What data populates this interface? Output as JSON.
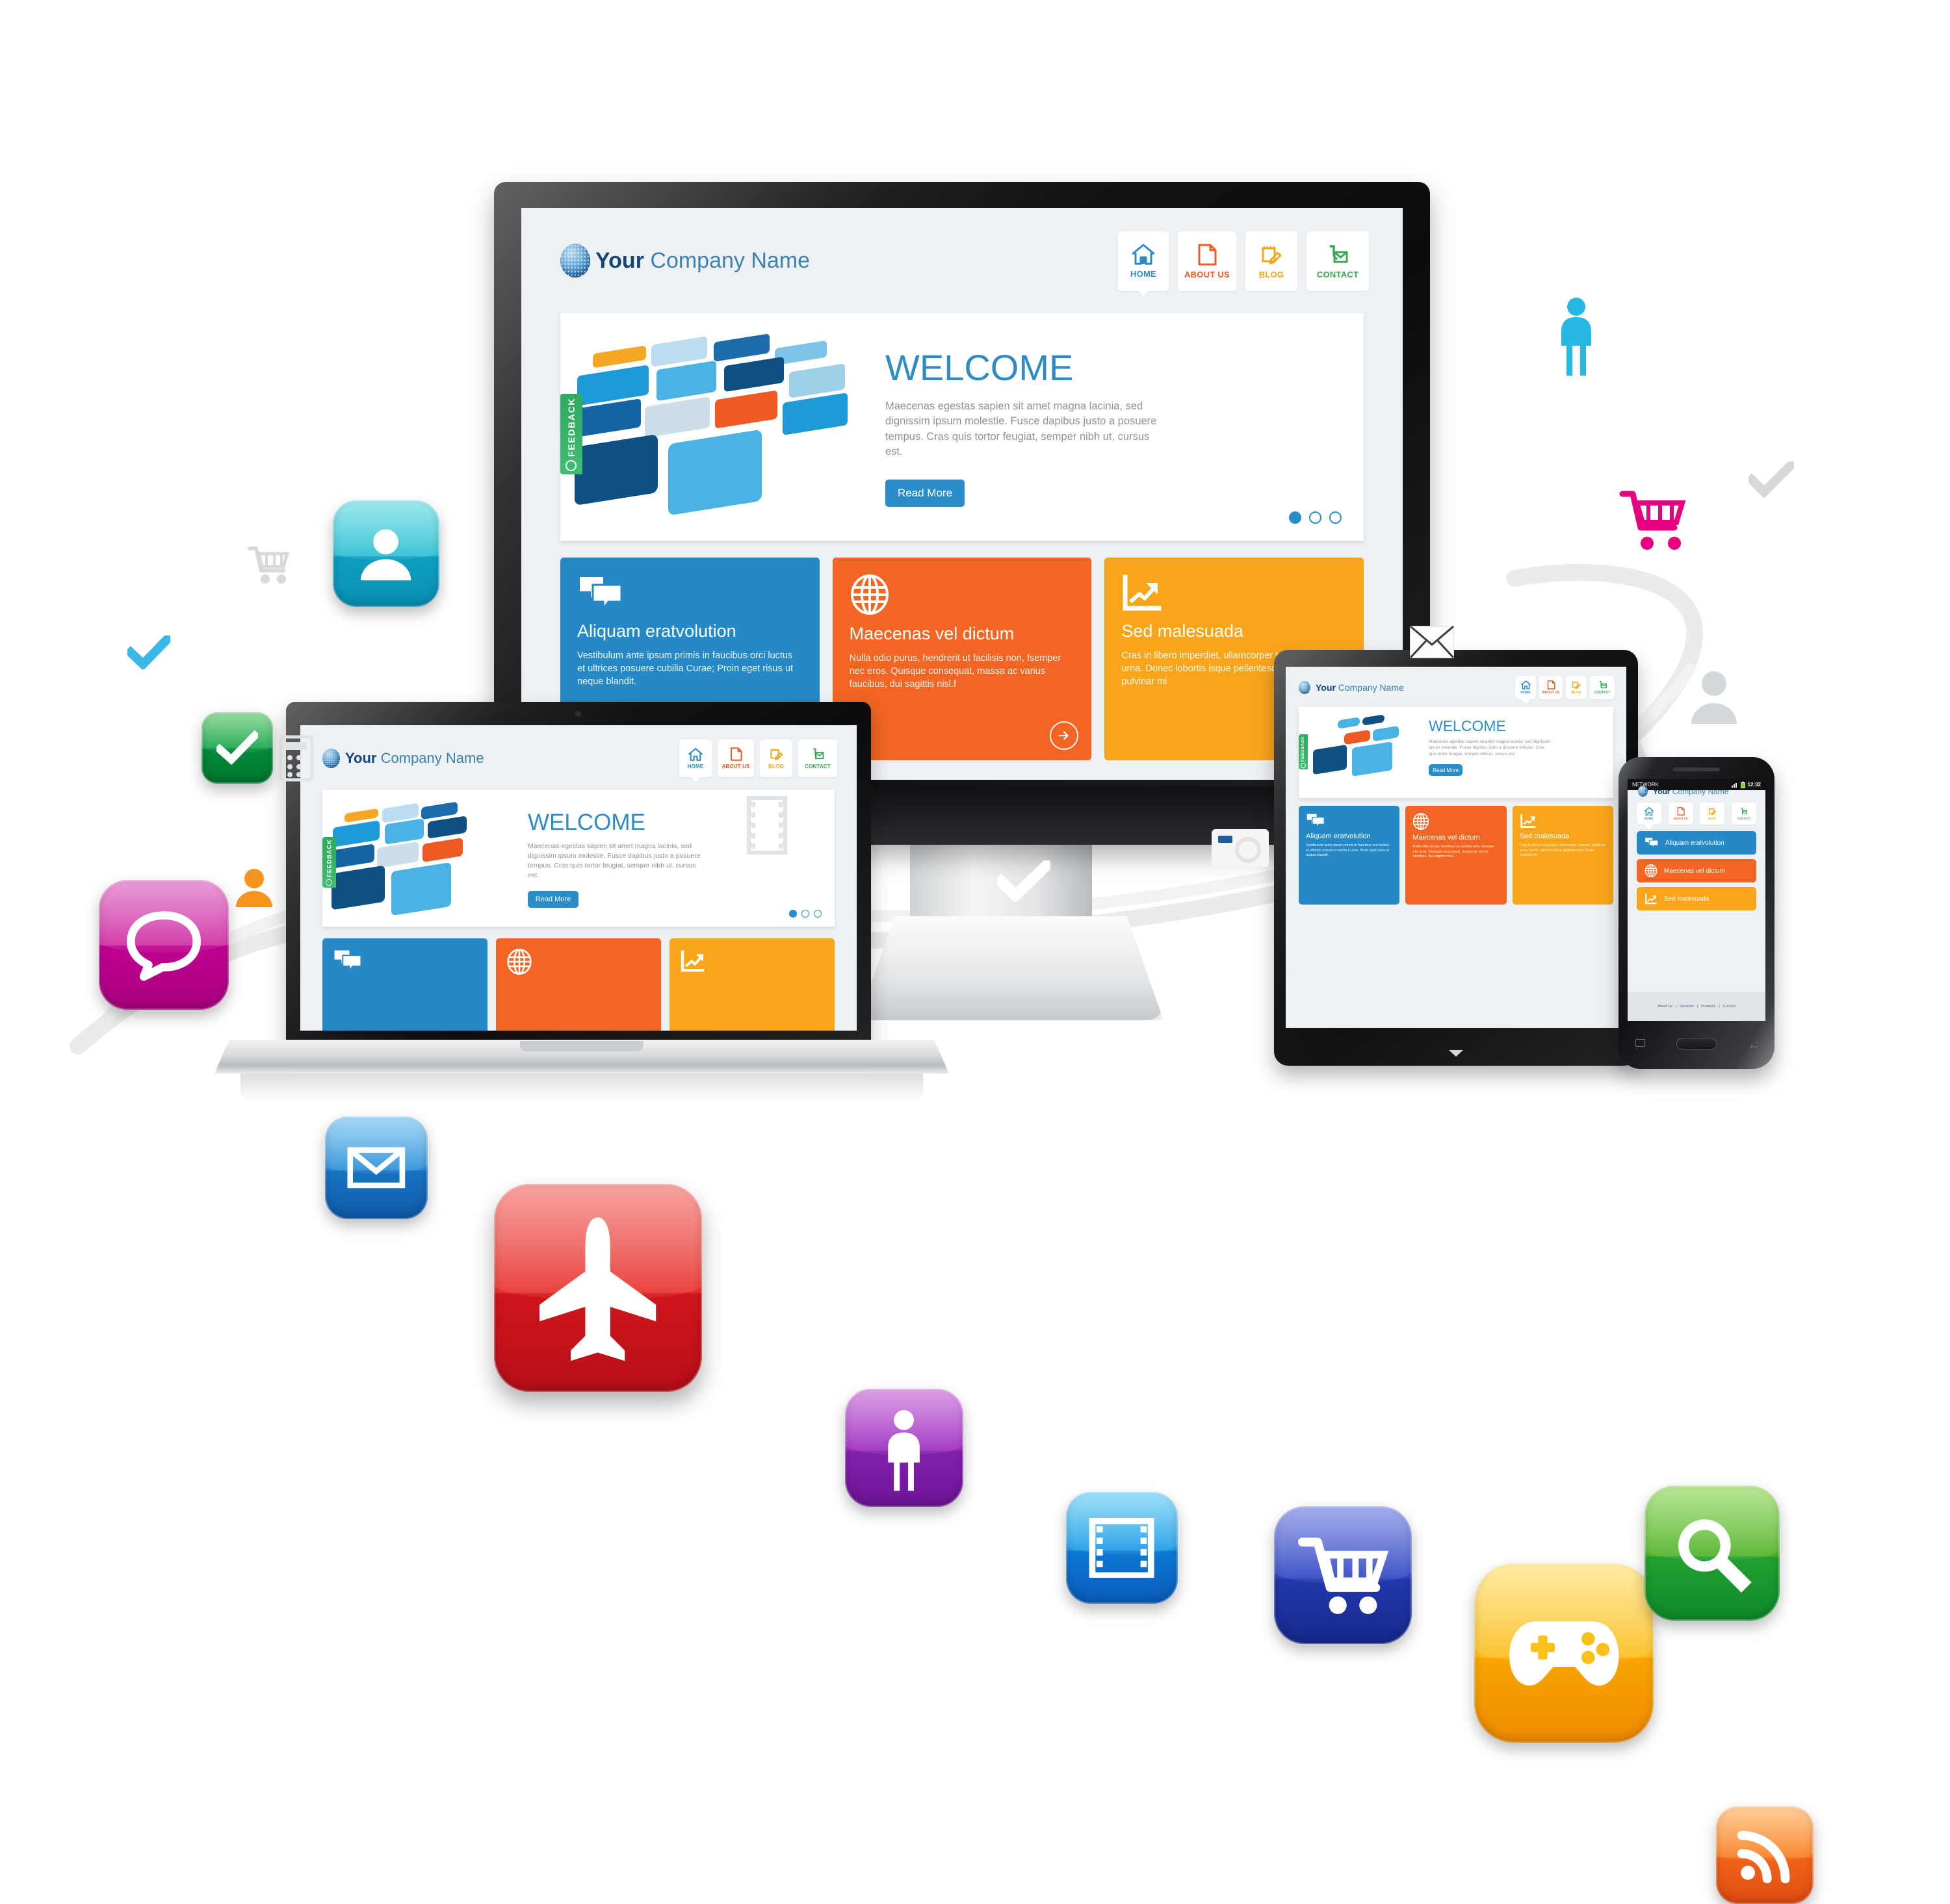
{
  "site": {
    "brand_bold": "Your",
    "brand_light": " Company Name",
    "nav": [
      {
        "label": "HOME",
        "icon": "home-icon",
        "color": "#2e8bc4",
        "active": true
      },
      {
        "label": "ABOUT US",
        "icon": "document-icon",
        "color": "#f05a28",
        "active": false
      },
      {
        "label": "BLOG",
        "icon": "notepad-pencil-icon",
        "color": "#f0a81e",
        "active": false
      },
      {
        "label": "CONTACT",
        "icon": "mail-phone-icon",
        "color": "#3aa85a",
        "active": false
      }
    ],
    "feedback_tab": "FEEDBACK",
    "hero": {
      "title": "WELCOME",
      "body": "Maecenas egestas sapien sit amet magna lacinia, sed dignissim ipsum molestie. Fusce dapibus justo a posuere tempus. Cras quis tortor feugiat, semper nibh ut, cursus est.",
      "button": "Read More",
      "slides": 3,
      "active_slide": 1
    },
    "cards": [
      {
        "title": "Aliquam eratvolution",
        "body": "Vestibulum ante ipsum primis in faucibus orci luctus et ultrices posuere cubilia Curae; Proin eget risus ut neque blandit.",
        "icon": "chat-bubbles-icon",
        "color": "#2489c6"
      },
      {
        "title": "Maecenas vel dictum",
        "body": "Nulla odio purus, hendrerit ut facilisis non, fsemper nec eros. Quisque consequat, massa ac varius faucibus, dui sagittis nisl.f",
        "icon": "globe-grid-icon",
        "color": "#f26522"
      },
      {
        "title": "Sed malesuada",
        "body": "Cras in libero imperdiet, ullamcorper tempor, eleifend urna. Donec lobortis isque pellentesque. Proin pulvinar mi",
        "icon": "growth-chart-icon",
        "color": "#f9a51a"
      }
    ]
  },
  "phone": {
    "carrier": "NETWORK",
    "time": "12:32",
    "status_icons": [
      "signal-icon",
      "battery-icon"
    ],
    "footer_links": [
      "About Us",
      "Services",
      "Products",
      "Contact"
    ],
    "footer_separator": "|"
  },
  "app_icons": [
    {
      "name": "user-avatar-icon",
      "glyph": "person-bust",
      "color_top": "#54d6dd",
      "color_bottom": "#0d9fc0"
    },
    {
      "name": "chat-bubble-icon",
      "glyph": "speech",
      "color_top": "#d12fa8",
      "color_bottom": "#c4008b"
    },
    {
      "name": "mail-icon",
      "glyph": "envelope",
      "color_top": "#5ab4ea",
      "color_bottom": "#1169ba"
    },
    {
      "name": "airplane-icon",
      "glyph": "airplane",
      "color_top": "#ef4b46",
      "color_bottom": "#cf1721"
    },
    {
      "name": "checkmark-icon",
      "glyph": "check",
      "color_top": "#3cb34a",
      "color_bottom": "#018a3b"
    },
    {
      "name": "male-person-icon",
      "glyph": "person-full",
      "color_top": "#b446c8",
      "color_bottom": "#7d1fa4"
    },
    {
      "name": "film-strip-icon",
      "glyph": "film",
      "color_top": "#3bbdf0",
      "color_bottom": "#0a63c6"
    },
    {
      "name": "shopping-cart-icon",
      "glyph": "cart",
      "color_top": "#4a5fd0",
      "color_bottom": "#1b3ba8"
    },
    {
      "name": "game-controller-icon",
      "glyph": "gamepad",
      "color_top": "#fdd048",
      "color_bottom": "#f79100"
    },
    {
      "name": "search-icon",
      "glyph": "magnifier",
      "color_top": "#62c02f",
      "color_bottom": "#109b2f"
    },
    {
      "name": "rss-icon",
      "glyph": "rss",
      "color_top": "#fa8c33",
      "color_bottom": "#ef5a16"
    }
  ],
  "flat_icons": [
    {
      "name": "cart-outline-icon-grey",
      "color": "#d7d9db"
    },
    {
      "name": "cart-outline-icon-pink",
      "color": "#e6007e"
    },
    {
      "name": "check-icon-blue",
      "color": "#3bb7e8"
    },
    {
      "name": "check-icon-grey",
      "color": "#d6d8da"
    },
    {
      "name": "check-icon-white",
      "color": "#ffffff"
    },
    {
      "name": "person-icon-cyan",
      "color": "#26b9e6"
    },
    {
      "name": "person-icon-orange",
      "color": "#f7941e"
    },
    {
      "name": "person-icon-grey",
      "color": "#cfd2d4"
    },
    {
      "name": "envelope-icon-white",
      "color": "#ffffff"
    },
    {
      "name": "camera-icon-white",
      "color": "#f2f3f4"
    },
    {
      "name": "film-icon-grey",
      "color": "#e3e5e7"
    },
    {
      "name": "calculator-icon-grey",
      "color": "#e3e5e7"
    }
  ],
  "colors": {
    "brand_blue": "#2e8bc4",
    "brand_dark": "#12457a",
    "card_blue": "#2489c6",
    "card_orange": "#f26522",
    "card_amber": "#f9a51a",
    "feedback_green": "#2faa60",
    "page_bg": "#ffffff"
  }
}
